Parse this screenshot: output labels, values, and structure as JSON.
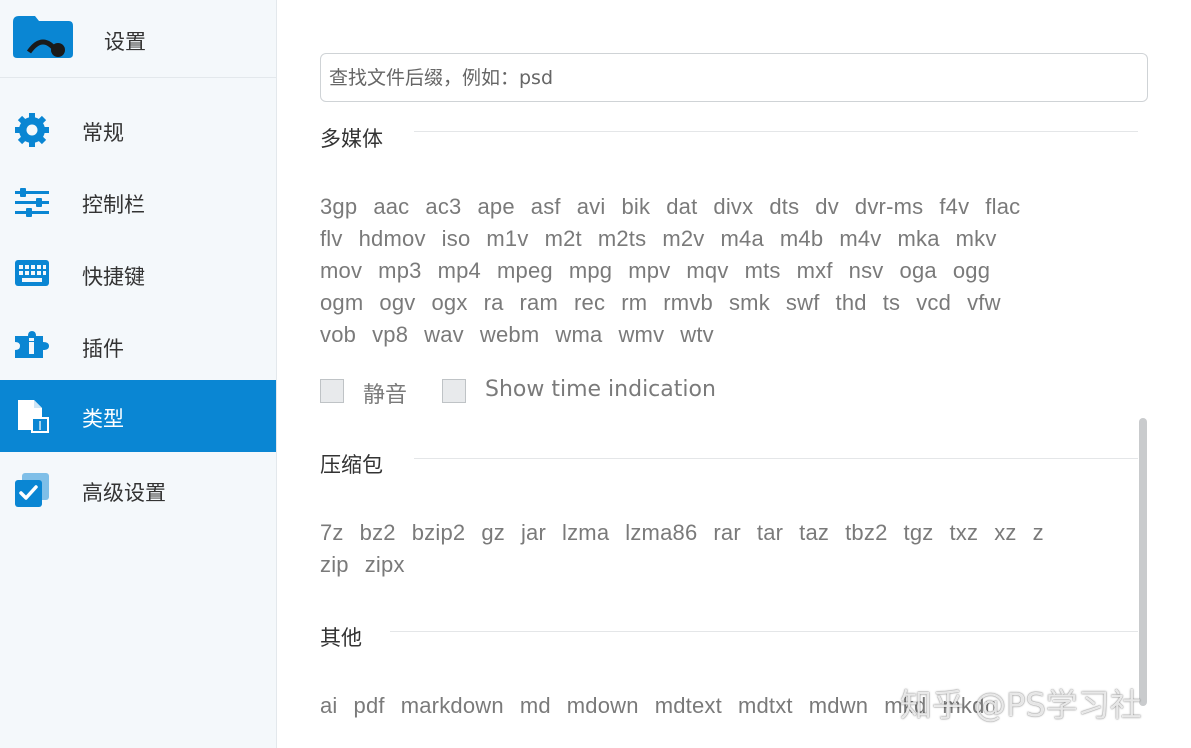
{
  "sidebar": {
    "title": "设置",
    "items": [
      {
        "label": "常规",
        "icon": "gear-icon"
      },
      {
        "label": "控制栏",
        "icon": "sliders-icon"
      },
      {
        "label": "快捷键",
        "icon": "keyboard-icon"
      },
      {
        "label": "插件",
        "icon": "puzzle-icon"
      },
      {
        "label": "类型",
        "icon": "file-type-icon",
        "active": true
      },
      {
        "label": "高级设置",
        "icon": "checkbox-stack-icon"
      }
    ],
    "accent": "#0a86d3"
  },
  "main": {
    "search_placeholder": "查找文件后缀，例如：psd",
    "sections": [
      {
        "title": "多媒体",
        "lines": [
          [
            "3gp",
            "aac",
            "ac3",
            "ape",
            "asf",
            "avi",
            "bik",
            "dat",
            "divx",
            "dts",
            "dv",
            "dvr-ms",
            "f4v",
            "flac"
          ],
          [
            "flv",
            "hdmov",
            "iso",
            "m1v",
            "m2t",
            "m2ts",
            "m2v",
            "m4a",
            "m4b",
            "m4v",
            "mka",
            "mkv"
          ],
          [
            "mov",
            "mp3",
            "mp4",
            "mpeg",
            "mpg",
            "mpv",
            "mqv",
            "mts",
            "mxf",
            "nsv",
            "oga",
            "ogg"
          ],
          [
            "ogm",
            "ogv",
            "ogx",
            "ra",
            "ram",
            "rec",
            "rm",
            "rmvb",
            "smk",
            "swf",
            "thd",
            "ts",
            "vcd",
            "vfw"
          ],
          [
            "vob",
            "vp8",
            "wav",
            "webm",
            "wma",
            "wmv",
            "wtv"
          ]
        ],
        "checkboxes": [
          {
            "label": "静音",
            "checked": false
          },
          {
            "label": "Show time indication",
            "checked": false
          }
        ]
      },
      {
        "title": "压缩包",
        "lines": [
          [
            "7z",
            "bz2",
            "bzip2",
            "gz",
            "jar",
            "lzma",
            "lzma86",
            "rar",
            "tar",
            "taz",
            "tbz2",
            "tgz",
            "txz",
            "xz",
            "z"
          ],
          [
            "zip",
            "zipx"
          ]
        ]
      },
      {
        "title": "其他",
        "lines": [
          [
            "ai",
            "pdf",
            "markdown",
            "md",
            "mdown",
            "mdtext",
            "mdtxt",
            "mdwn",
            "mkd",
            "mkdn"
          ]
        ]
      }
    ]
  },
  "watermark": "知乎 @PS学习社"
}
